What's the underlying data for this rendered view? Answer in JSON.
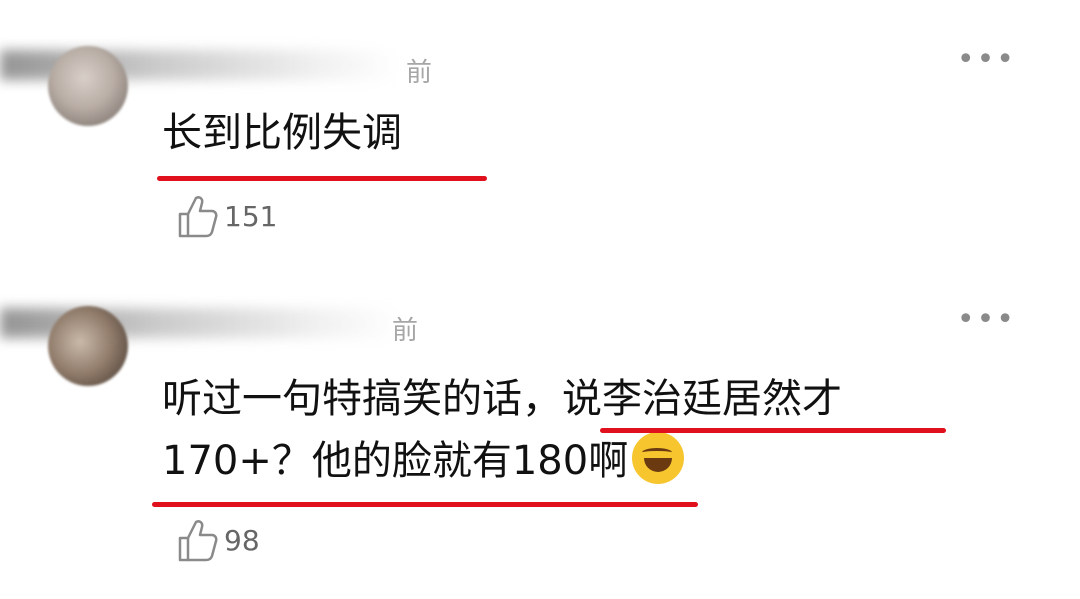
{
  "comments": [
    {
      "time": "前",
      "text": "长到比例失调",
      "likes": "151"
    },
    {
      "time": "前",
      "text_line1_a": "听过一句特搞笑的话，",
      "text_line1_b": "说李治廷居然才",
      "text_line2": "170+？他的脸就有180啊",
      "emoji": "laughing-with-tears-emoji",
      "likes": "98"
    }
  ],
  "icons": [
    "thumbs-up-icon",
    "more-dots-icon"
  ],
  "colors": {
    "underline": "#e0101d",
    "meta": "#a6a6a6",
    "text": "#111111",
    "emoji": "#f7c62f"
  }
}
